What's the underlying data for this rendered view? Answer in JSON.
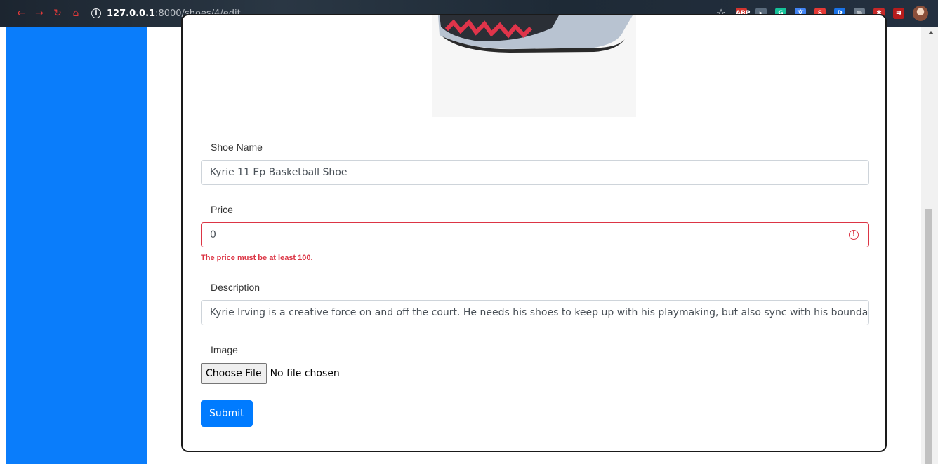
{
  "browser": {
    "url_host": "127.0.0.1",
    "url_path": ":8000/shoes/4/edit",
    "extensions": [
      {
        "name": "adblock-icon",
        "text": "ABP",
        "color": "#d3352f"
      },
      {
        "name": "cursor-extension-icon",
        "text": "▸",
        "color": "#5a6b7c"
      },
      {
        "name": "grammarly-icon",
        "text": "G",
        "color": "#15c39a"
      },
      {
        "name": "translate-icon",
        "text": "文",
        "color": "#4285f4"
      },
      {
        "name": "s-extension-icon",
        "text": "S",
        "color": "#e53935"
      },
      {
        "name": "d-extension-icon",
        "text": "D",
        "color": "#1a73e8"
      },
      {
        "name": "globe-icon",
        "text": "◍",
        "color": "#6c7a89"
      },
      {
        "name": "puzzle-icon",
        "text": "✱",
        "color": "#c62828"
      },
      {
        "name": "cast-icon",
        "text": "⇉",
        "color": "#b71c1c"
      }
    ]
  },
  "form": {
    "shoe_name": {
      "label": "Shoe Name",
      "value": "Kyrie 11 Ep Basketball Shoe"
    },
    "price": {
      "label": "Price",
      "value": "0",
      "error": "The price must be at least 100."
    },
    "description": {
      "label": "Description",
      "value": "Kyrie Irving is a creative force on and off the court. He needs his shoes to keep up with his playmaking, but also sync with his boundary-pushing style."
    },
    "image": {
      "label": "Image",
      "button": "Choose File",
      "status": "No file chosen"
    },
    "submit_label": "Submit"
  },
  "colors": {
    "sidebar": "#0a7dfb",
    "primary": "#007bff",
    "danger": "#dc3545"
  }
}
